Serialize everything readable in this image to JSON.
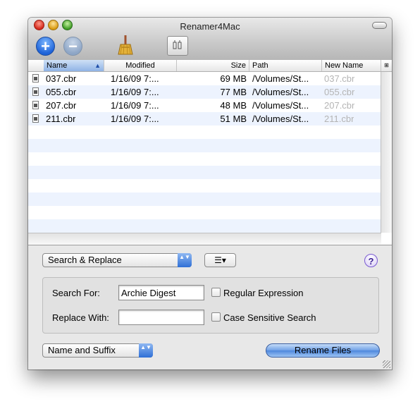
{
  "window": {
    "title": "Renamer4Mac"
  },
  "toolbar": {
    "add_icon": "plus-icon",
    "remove_icon": "minus-icon",
    "add_glyph": "+",
    "remove_glyph": "−",
    "clean_icon": "broom-icon",
    "preview_icon": "preview-icon"
  },
  "table": {
    "columns": [
      {
        "label": "Name",
        "sorted": "ascending"
      },
      {
        "label": "Modified"
      },
      {
        "label": "Size"
      },
      {
        "label": "Path"
      },
      {
        "label": "New Name"
      }
    ],
    "sort_indicator": "▲",
    "rows": [
      {
        "name": "037.cbr",
        "modified": "1/16/09 7:...",
        "size": "69 MB",
        "path": "/Volumes/St...",
        "new_name": "037.cbr"
      },
      {
        "name": "055.cbr",
        "modified": "1/16/09 7:...",
        "size": "77 MB",
        "path": "/Volumes/St...",
        "new_name": "055.cbr"
      },
      {
        "name": "207.cbr",
        "modified": "1/16/09 7:...",
        "size": "48 MB",
        "path": "/Volumes/St...",
        "new_name": "207.cbr"
      },
      {
        "name": "211.cbr",
        "modified": "1/16/09 7:...",
        "size": "51 MB",
        "path": "/Volumes/St...",
        "new_name": "211.cbr"
      }
    ]
  },
  "rename_mode": {
    "selected": "Search & Replace"
  },
  "action_menu_glyph": "☰▾",
  "help_label": "?",
  "search": {
    "search_label": "Search For:",
    "search_value": "Archie Digest",
    "replace_label": "Replace With:",
    "replace_value": "",
    "regex_label": "Regular Expression",
    "regex_checked": false,
    "case_label": "Case Sensitive Search",
    "case_checked": false
  },
  "apply_to": {
    "selected": "Name and Suffix"
  },
  "rename_button": "Rename Files",
  "popup_arrows": "▲▼"
}
